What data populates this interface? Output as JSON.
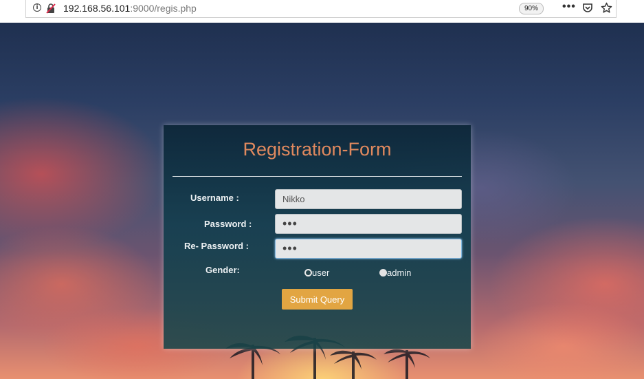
{
  "browser": {
    "info_icon": "info-icon",
    "security_icon": "insecure-lock-icon",
    "url_host": "192.168.56.101",
    "url_rest": ":9000/regis.php",
    "zoom": "90%",
    "more_label": "•••",
    "pocket_icon": "pocket-icon",
    "bookmark_icon": "star-icon"
  },
  "form": {
    "title": "Registration-Form",
    "username_label": "Username :",
    "username_value": "Nikko",
    "password_label": "Password :",
    "password_value": "•••",
    "repassword_label": "Re- Password :",
    "repassword_value": "•••",
    "gender_label": "Gender:",
    "gender_options": [
      {
        "label": "user",
        "selected": true
      },
      {
        "label": "admin",
        "selected": false
      }
    ],
    "submit_label": "Submit Query"
  },
  "colors": {
    "title": "#e0895e",
    "submit": "#e2a542"
  }
}
